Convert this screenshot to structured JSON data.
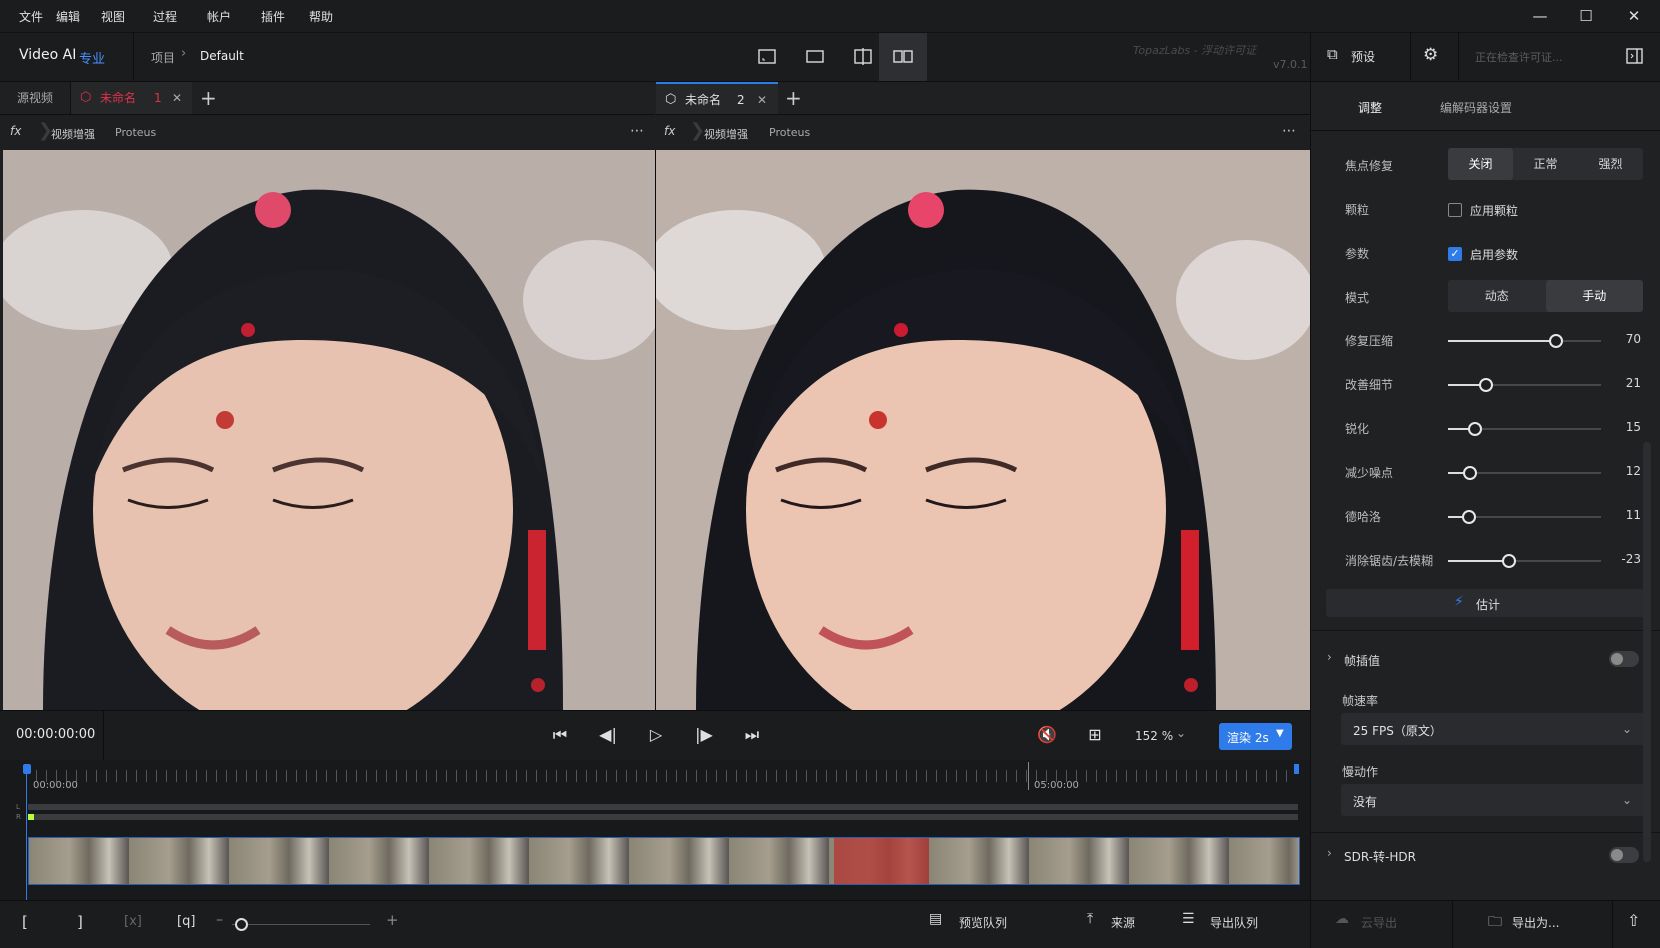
{
  "menu": [
    "文件",
    "编辑",
    "视图",
    "过程",
    "帐户",
    "插件",
    "帮助"
  ],
  "app": {
    "name": "Video AI",
    "edition": "专业"
  },
  "breadcrumb": {
    "root": "项目",
    "current": "Default"
  },
  "watermark": "TopazLabs - 浮动许可证",
  "version": "v7.0.1",
  "preset_label": "预设",
  "license_status": "正在检查许可证...",
  "left_tabs": {
    "source": "源视频",
    "name": "未命名",
    "number": "1"
  },
  "right_tabs": {
    "name": "未命名",
    "number": "2"
  },
  "fx_row": {
    "icon": "fx",
    "enhance": "视频增强",
    "model": "Proteus",
    "more": "⋯"
  },
  "panel": {
    "tabs": [
      "调整",
      "编解码器设置"
    ],
    "focus_fix": {
      "label": "焦点修复",
      "options": [
        "关闭",
        "正常",
        "强烈"
      ],
      "selected": "关闭"
    },
    "grain": {
      "label": "颗粒",
      "checkbox": "应用颗粒",
      "checked": false
    },
    "params": {
      "label": "参数",
      "checkbox": "启用参数",
      "checked": true
    },
    "mode": {
      "label": "模式",
      "options": [
        "动态",
        "手动"
      ],
      "selected": "手动"
    },
    "sliders": [
      {
        "label": "修复压缩",
        "value": "70",
        "fraction": 0.7
      },
      {
        "label": "改善细节",
        "value": "21",
        "fraction": 0.24
      },
      {
        "label": "锐化",
        "value": "15",
        "fraction": 0.17
      },
      {
        "label": "减少噪点",
        "value": "12",
        "fraction": 0.14
      },
      {
        "label": "德哈洛",
        "value": "11",
        "fraction": 0.13
      },
      {
        "label": "消除锯齿/去模糊",
        "value": "-23",
        "fraction": 0.39
      }
    ],
    "estimate": "估计",
    "frame_interp": {
      "label": "帧插值",
      "enabled": false
    },
    "frame_rate": {
      "label": "帧速率",
      "value": "25 FPS（原文）"
    },
    "slow_motion": {
      "label": "慢动作",
      "value": "没有"
    },
    "sdr_hdr": {
      "label": "SDR-转-HDR",
      "enabled": false
    }
  },
  "controls": {
    "timecode": "00:00:00:00",
    "zoom": "152 %",
    "render": "渲染 2s"
  },
  "timeline": {
    "start": "00:00:00",
    "mark": "05:00:00",
    "channel_l": "L",
    "channel_r": "R"
  },
  "bottom": {
    "preview_queue": "预览队列",
    "source": "来源",
    "export_queue": "导出队列",
    "cloud_export": "云导出",
    "export_as": "导出为..."
  },
  "colors": {
    "accent": "#2f7bea",
    "tab_active": "#e0324b",
    "bg": "#1e1f21"
  }
}
